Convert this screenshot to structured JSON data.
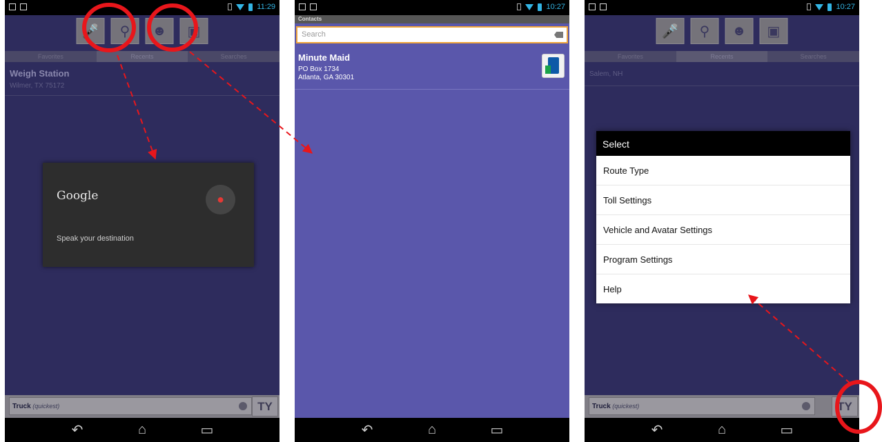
{
  "phone1": {
    "status_time": "11:29",
    "toolbar": [
      "mic-icon",
      "search-icon",
      "contacts-icon",
      "map-icon"
    ],
    "tabs": [
      "Favorites",
      "Recents",
      "Searches"
    ],
    "recent": {
      "title": "Weigh Station",
      "subtitle": "Wilmer, TX 75172"
    },
    "voice": {
      "brand": "Google",
      "prompt": "Speak your destination"
    },
    "route": {
      "vehicle": "Truck",
      "mode": "(quickest)"
    },
    "tools_label": "TY"
  },
  "phone2": {
    "status_time": "10:27",
    "header": "Contacts",
    "search_placeholder": "Search",
    "contact": {
      "name": "Minute Maid",
      "line1": "PO Box 1734",
      "line2": "Atlanta, GA 30301"
    }
  },
  "phone3": {
    "status_time": "10:27",
    "tabs": [
      "Favorites",
      "Recents",
      "Searches"
    ],
    "recent": {
      "title": "Salem, NH"
    },
    "select": {
      "title": "Select",
      "items": [
        "Route Type",
        "Toll Settings",
        "Vehicle and Avatar Settings",
        "Program Settings",
        "Help"
      ]
    },
    "route": {
      "vehicle": "Truck",
      "mode": "(quickest)"
    },
    "tools_label": "TY"
  },
  "nav_icons": [
    "back-icon",
    "home-icon",
    "recents-icon"
  ],
  "colors": {
    "app_bg": "#2e2c5d",
    "contacts_bg": "#5a57ab",
    "annotation": "#e8161b"
  }
}
